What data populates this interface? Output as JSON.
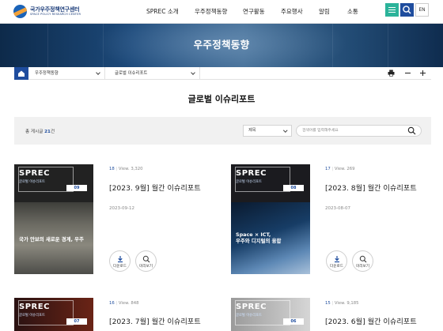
{
  "header": {
    "logo_ko": "국가우주정책연구센터",
    "logo_en": "SPACE POLICY RESEARCH CENTER",
    "nav": [
      "SPREC 소개",
      "우주정책동향",
      "연구활동",
      "주요행사",
      "알림",
      "소통"
    ],
    "lang": "EN"
  },
  "hero": {
    "title": "우주정책동향"
  },
  "breadcrumb": {
    "first": "우주정책동향",
    "second": "글로벌 이슈리포트"
  },
  "page": {
    "title": "글로벌 이슈리포트"
  },
  "filter": {
    "total_prefix": "총 게시글",
    "total_count": "21",
    "total_suffix": "건",
    "select_value": "제목",
    "search_placeholder": "검색어를 입력해주세요"
  },
  "cards": [
    {
      "no": "18",
      "views": "View. 3,320",
      "title": "[2023. 9월] 월간 이슈리포트",
      "date": "2023-09-12",
      "cover_title": "SPREC",
      "cover_sub": "글로벌 이슈리포트",
      "cover_issue": "09",
      "cover_headline": "국가 안보의 새로운 경계, 우주",
      "download": "다운로드",
      "preview": "미리보기"
    },
    {
      "no": "17",
      "views": "View. 269",
      "title": "[2023. 8월] 월간 이슈리포트",
      "date": "2023-08-07",
      "cover_title": "SPREC",
      "cover_sub": "글로벌 이슈리포트",
      "cover_issue": "08",
      "cover_headline": "Space × ICT,\n우주와 디지털의 융합",
      "download": "다운로드",
      "preview": "미리보기"
    },
    {
      "no": "16",
      "views": "View. 848",
      "title": "[2023. 7월] 월간 이슈리포트",
      "date": "",
      "cover_title": "SPREC",
      "cover_sub": "글로벌 이슈리포트",
      "cover_issue": "07",
      "cover_headline": "",
      "download": "",
      "preview": ""
    },
    {
      "no": "15",
      "views": "View. 9,185",
      "title": "[2023. 6월] 월간 이슈리포트",
      "date": "",
      "cover_title": "SPREC",
      "cover_sub": "글로벌 이슈리포트",
      "cover_issue": "06",
      "cover_headline": "",
      "download": "",
      "preview": ""
    }
  ],
  "colors": {
    "accent": "#1f4d9e",
    "menu_button": "#2bb39a"
  },
  "icons": [
    "menu-icon",
    "search-icon",
    "home-icon",
    "print-icon",
    "minus-icon",
    "plus-icon",
    "download-icon",
    "magnifier-icon"
  ]
}
